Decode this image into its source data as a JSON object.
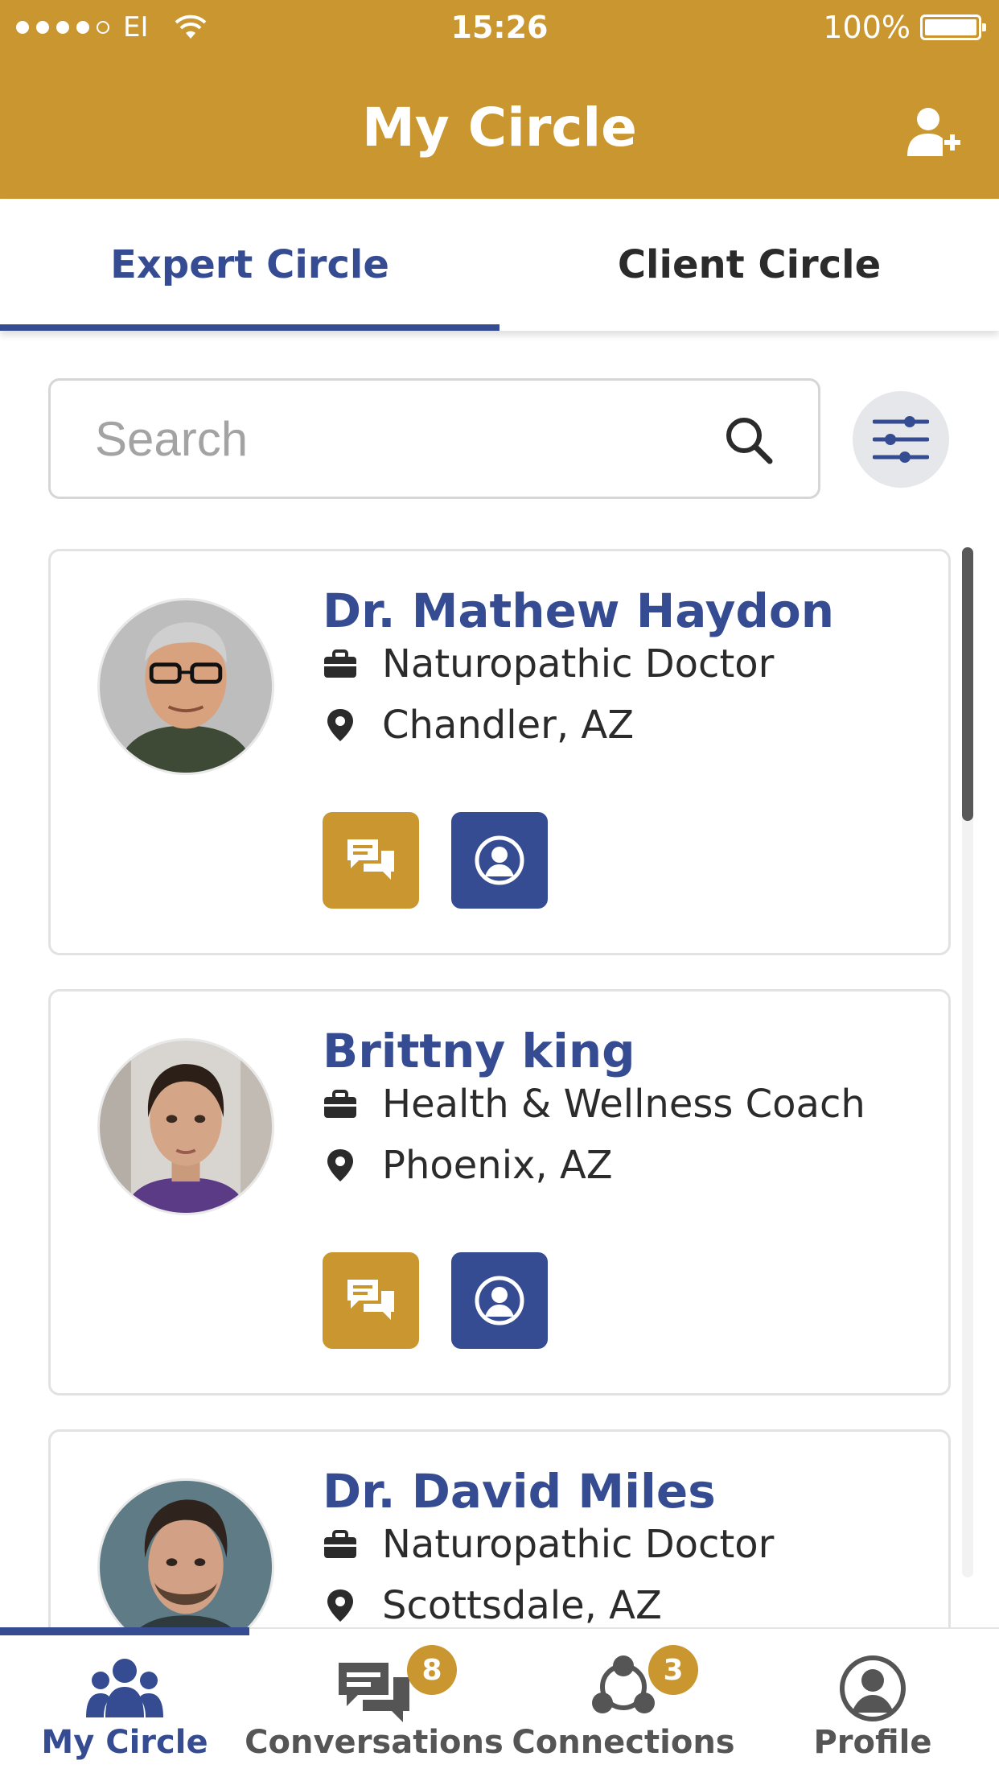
{
  "status_bar": {
    "carrier": "EI",
    "time": "15:26",
    "battery": "100%"
  },
  "header": {
    "title": "My Circle",
    "add_icon": "add-user-icon"
  },
  "tabs": [
    {
      "label": "Expert Circle",
      "active": true
    },
    {
      "label": "Client Circle",
      "active": false
    }
  ],
  "search": {
    "placeholder": "Search",
    "value": ""
  },
  "experts": [
    {
      "name": "Dr. Mathew Haydon",
      "profession": "Naturopathic Doctor",
      "location": "Chandler, AZ"
    },
    {
      "name": "Brittny king",
      "profession": "Health & Wellness Coach",
      "location": "Phoenix, AZ"
    },
    {
      "name": "Dr. David Miles",
      "profession": "Naturopathic Doctor",
      "location": "Scottsdale, AZ"
    }
  ],
  "bottom_nav": [
    {
      "label": "My Circle",
      "icon": "group-icon",
      "active": true
    },
    {
      "label": "Conversations",
      "icon": "chat-icon",
      "badge": "8"
    },
    {
      "label": "Connections",
      "icon": "connections-icon",
      "badge": "3"
    },
    {
      "label": "Profile",
      "icon": "user-circle-icon"
    }
  ],
  "colors": {
    "gold": "#c9962f",
    "navy": "#354c92"
  }
}
